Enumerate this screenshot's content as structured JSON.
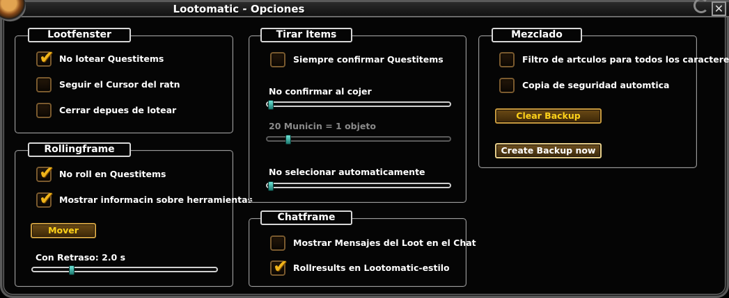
{
  "window": {
    "title": "Lootomatic - Opciones",
    "close_glyph": "✕"
  },
  "lootfenster": {
    "title": "Lootfenster",
    "items": [
      {
        "label": "No lotear Questitems",
        "checked": true
      },
      {
        "label": "Seguir el Cursor del ratn",
        "checked": false
      },
      {
        "label": "Cerrar depues de lotear",
        "checked": false
      }
    ]
  },
  "rollingframe": {
    "title": "Rollingframe",
    "items": [
      {
        "label": "No roll en Questitems",
        "checked": true
      },
      {
        "label": "Mostrar informacin sobre herramientas",
        "checked": true
      }
    ],
    "move_button": "Mover",
    "delay_label": "Con Retraso: 2.0 s",
    "delay_fraction": 0.2
  },
  "tirar_items": {
    "title": "Tirar Items",
    "items": [
      {
        "label": "Siempre confirmar Questitems",
        "checked": false
      }
    ],
    "slider_confirm_label": "No confirmar al cojer",
    "slider_confirm_fraction": 0.0,
    "slider_ammo_label": "20 Municin = 1 objeto",
    "slider_ammo_fraction": 0.1,
    "slider_autoselect_label": "No selecionar automaticamente",
    "slider_autoselect_fraction": 0.0
  },
  "chatframe": {
    "title": "Chatframe",
    "items": [
      {
        "label": "Mostrar Mensajes del Loot en el Chat",
        "checked": false
      },
      {
        "label": "Rollresults en Lootomatic-estilo",
        "checked": true
      }
    ]
  },
  "mezclado": {
    "title": "Mezclado",
    "items": [
      {
        "label": "Filtro de artculos para todos los caracteres",
        "checked": false
      },
      {
        "label": "Copia de seguridad automtica",
        "checked": false
      }
    ],
    "clear_backup_button": "Clear Backup",
    "create_backup_button": "Create Backup now"
  },
  "colors": {
    "accent": "#ffd21a",
    "check": "#f0b41a",
    "border": "#9a9a9a",
    "slider_thumb": "#3fb8aa"
  }
}
